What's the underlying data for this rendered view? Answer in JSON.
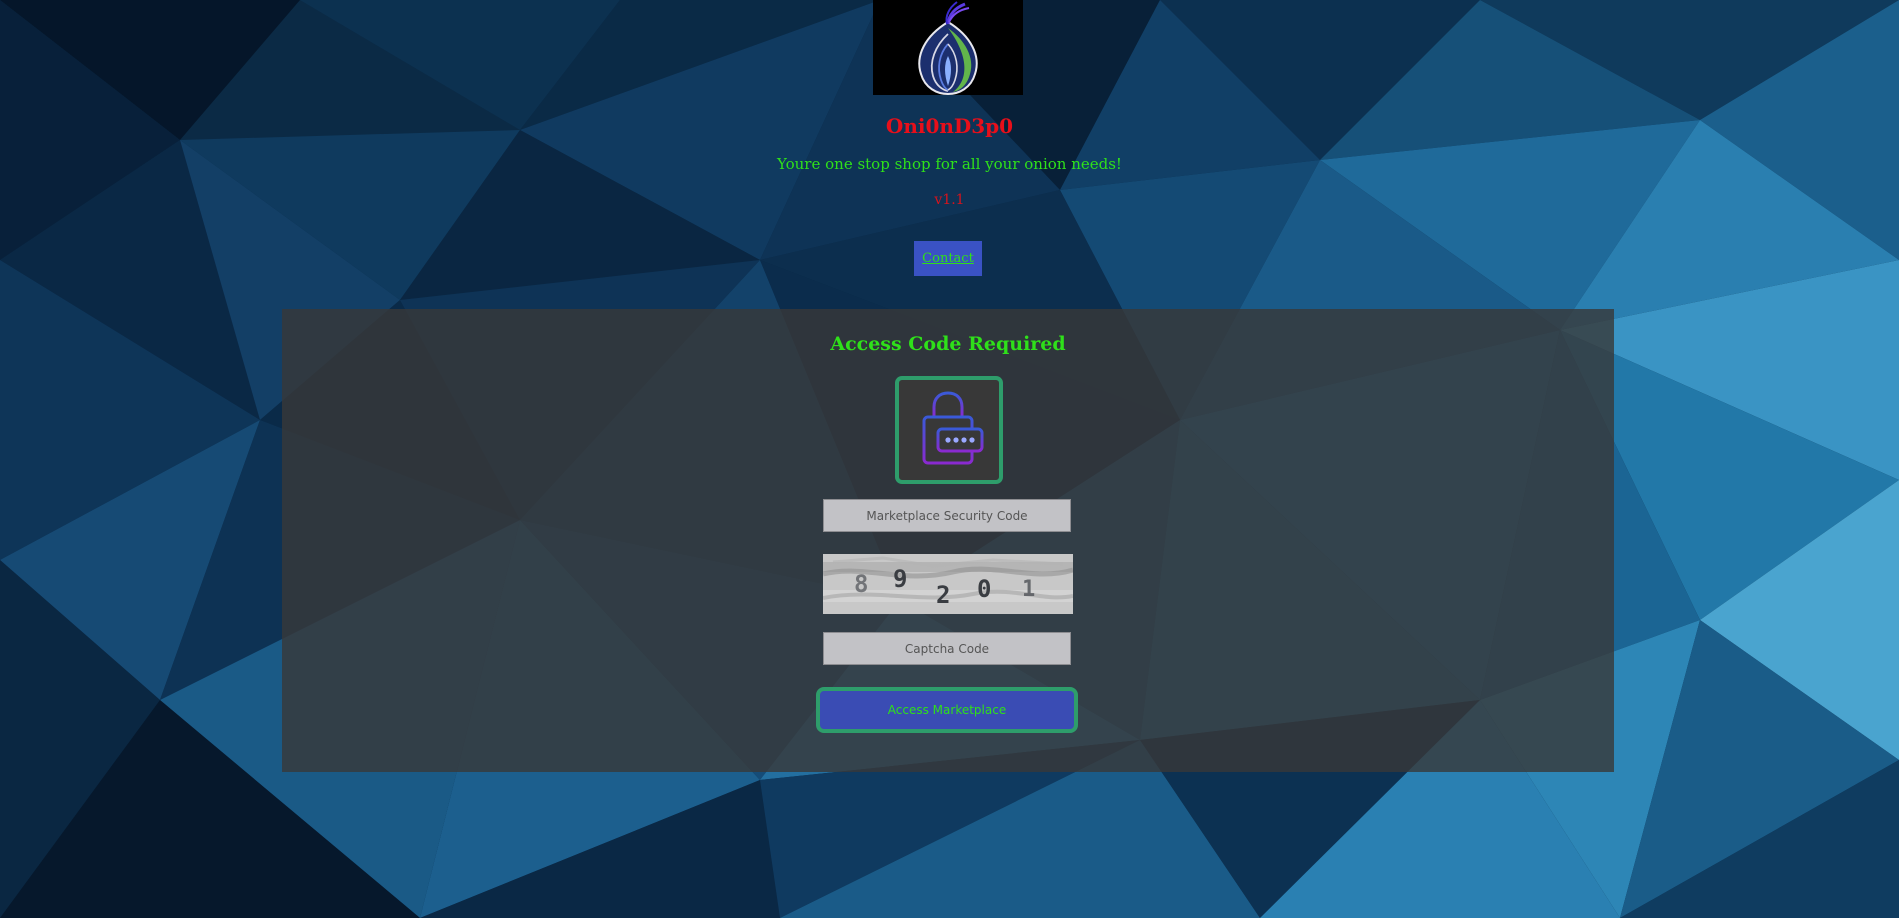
{
  "header": {
    "site_title": "Oni0nD3p0",
    "tagline": "Youre one stop shop for all your onion needs!",
    "version": "v1.1",
    "contact_label": "Contact",
    "logo_icon": "onion-logo-icon"
  },
  "panel": {
    "title": "Access Code Required",
    "lock_icon": "padlock-password-icon",
    "security_code_placeholder": "Marketplace Security Code",
    "captcha_digits": [
      "8",
      "9",
      "2",
      "0",
      "1"
    ],
    "captcha_placeholder": "Captcha Code",
    "access_button_label": "Access Marketplace"
  },
  "colors": {
    "title_red": "#e80f1a",
    "text_green": "#2fe01a",
    "button_blue": "#3a52c4",
    "border_teal": "#2e9d6b",
    "panel_bg": "#383838"
  }
}
